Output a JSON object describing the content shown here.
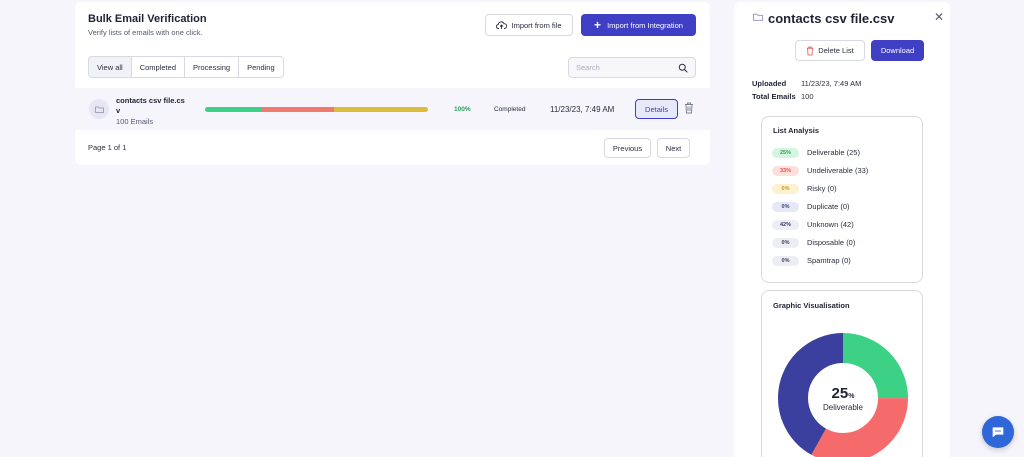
{
  "header": {
    "title": "Bulk Email Verification",
    "subtitle": "Verify lists of emails with one click.",
    "import_file_label": "Import from file",
    "import_integration_label": "Import from Integration"
  },
  "tabs": [
    {
      "label": "View all"
    },
    {
      "label": "Completed"
    },
    {
      "label": "Processing"
    },
    {
      "label": "Pending"
    }
  ],
  "search": {
    "placeholder": "Search",
    "value": ""
  },
  "list": {
    "rows": [
      {
        "file_name": "contacts csv file.csv",
        "email_count": "100 Emails",
        "progress_percent": "100%",
        "status": "Completed",
        "date": "11/23/23, 7:49 AM",
        "details_label": "Details"
      }
    ]
  },
  "pagination": {
    "label": "Page 1 of 1",
    "previous_label": "Previous",
    "next_label": "Next"
  },
  "panel": {
    "title": "contacts csv file.csv",
    "delete_label": "Delete List",
    "download_label": "Download",
    "uploaded_label": "Uploaded",
    "uploaded_value": "11/23/23, 7:49 AM",
    "total_label": "Total Emails",
    "total_value": "100",
    "analysis_title": "List Analysis",
    "analysis": [
      {
        "pct": "25%",
        "text": "Deliverable (25)",
        "value": 25,
        "pill_bg": "#d5f5e1",
        "pill_fg": "#2ea15d"
      },
      {
        "pct": "33%",
        "text": "Undeliverable (33)",
        "value": 33,
        "pill_bg": "#fde0de",
        "pill_fg": "#e0534d"
      },
      {
        "pct": "0%",
        "text": "Risky (0)",
        "value": 0,
        "pill_bg": "#fdf1d0",
        "pill_fg": "#c99a16"
      },
      {
        "pct": "0%",
        "text": "Duplicate (0)",
        "value": 0,
        "pill_bg": "#e7e8f6",
        "pill_fg": "#3a3d80"
      },
      {
        "pct": "42%",
        "text": "Unknown (42)",
        "value": 42,
        "pill_bg": "#ededf5",
        "pill_fg": "#3a3d5a"
      },
      {
        "pct": "0%",
        "text": "Disposable (0)",
        "value": 0,
        "pill_bg": "#ededf5",
        "pill_fg": "#3a3d5a"
      },
      {
        "pct": "0%",
        "text": "Spamtrap (0)",
        "value": 0,
        "pill_bg": "#ededf5",
        "pill_fg": "#3a3d5a"
      }
    ],
    "vis_title": "Graphic Visualisation",
    "donut_value": "25",
    "donut_unit": "%",
    "donut_label": "Deliverable"
  },
  "colors": {
    "accent": "#3f3fc5",
    "deliverable": "#3dd185",
    "undeliverable": "#f56b6b",
    "unknown": "#3b3f9e",
    "progress_green": "#3dd185",
    "progress_red": "#f07a6e",
    "progress_yellow": "#d9bd3b"
  },
  "icons": {
    "import_file": "cloud-upload-icon",
    "trash": "trash-icon",
    "folder": "folder-icon",
    "close": "close-icon",
    "search": "search-icon",
    "chat": "chat-icon"
  }
}
